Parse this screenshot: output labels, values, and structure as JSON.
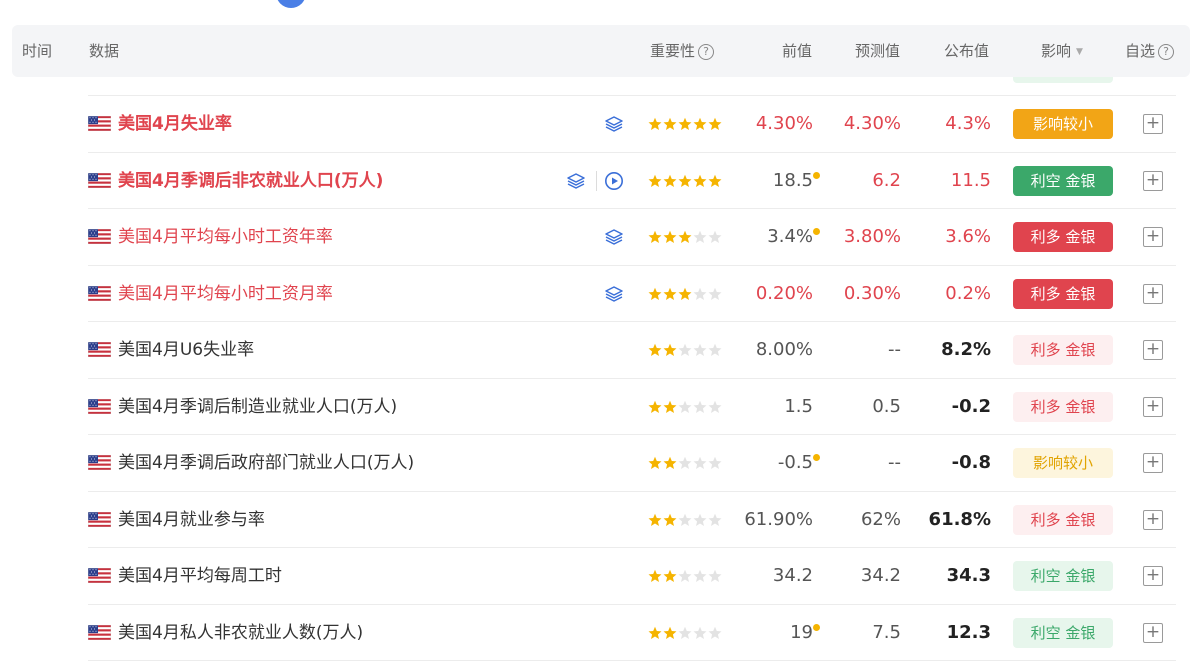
{
  "header": {
    "time": "时间",
    "data": "数据",
    "importance": "重要性",
    "previous": "前值",
    "forecast": "预测值",
    "actual": "公布值",
    "influence": "影响",
    "favorite": "自选",
    "help_glyph": "?",
    "caret_glyph": "▼"
  },
  "colors": {
    "accent_red": "#e0444e",
    "accent_green": "#3ba86a",
    "accent_orange": "#f2a516",
    "star_gold": "#f5b400",
    "star_gray": "#e3e3e3"
  },
  "add_glyph": "+",
  "rows": [
    {
      "name": "美国4月失业率",
      "rating": 5,
      "icons": [
        "layers-icon"
      ],
      "previous": "4.30%",
      "forecast": "4.30%",
      "actual": "4.3%",
      "prev_revised": false,
      "influence": "影响较小",
      "influence_style": "orange"
    },
    {
      "name": "美国4月季调后非农就业人口(万人)",
      "rating": 5,
      "icons": [
        "layers-icon",
        "play-icon"
      ],
      "previous": "18.5",
      "forecast": "6.2",
      "actual": "11.5",
      "prev_revised": true,
      "influence": "利空 金银",
      "influence_style": "green"
    },
    {
      "name": "美国4月平均每小时工资年率",
      "rating": 3,
      "icons": [
        "layers-icon"
      ],
      "previous": "3.4%",
      "forecast": "3.80%",
      "actual": "3.6%",
      "prev_revised": true,
      "influence": "利多 金银",
      "influence_style": "red"
    },
    {
      "name": "美国4月平均每小时工资月率",
      "rating": 3,
      "icons": [
        "layers-icon"
      ],
      "previous": "0.20%",
      "forecast": "0.30%",
      "actual": "0.2%",
      "prev_revised": false,
      "influence": "利多 金银",
      "influence_style": "red"
    },
    {
      "name": "美国4月U6失业率",
      "rating": 2,
      "icons": [],
      "previous": "8.00%",
      "forecast": "--",
      "actual": "8.2%",
      "prev_revised": false,
      "influence": "利多 金银",
      "influence_style": "lred"
    },
    {
      "name": "美国4月季调后制造业就业人口(万人)",
      "rating": 2,
      "icons": [],
      "previous": "1.5",
      "forecast": "0.5",
      "actual": "-0.2",
      "prev_revised": false,
      "influence": "利多 金银",
      "influence_style": "lred"
    },
    {
      "name": "美国4月季调后政府部门就业人口(万人)",
      "rating": 2,
      "icons": [],
      "previous": "-0.5",
      "forecast": "--",
      "actual": "-0.8",
      "prev_revised": true,
      "influence": "影响较小",
      "influence_style": "lyellow"
    },
    {
      "name": "美国4月就业参与率",
      "rating": 2,
      "icons": [],
      "previous": "61.90%",
      "forecast": "62%",
      "actual": "61.8%",
      "prev_revised": false,
      "influence": "利多 金银",
      "influence_style": "lred"
    },
    {
      "name": "美国4月平均每周工时",
      "rating": 2,
      "icons": [],
      "previous": "34.2",
      "forecast": "34.2",
      "actual": "34.3",
      "prev_revised": false,
      "influence": "利空 金银",
      "influence_style": "lgreen"
    },
    {
      "name": "美国4月私人非农就业人数(万人)",
      "rating": 2,
      "icons": [],
      "previous": "19",
      "forecast": "7.5",
      "actual": "12.3",
      "prev_revised": true,
      "influence": "利空 金银",
      "influence_style": "lgreen"
    }
  ]
}
